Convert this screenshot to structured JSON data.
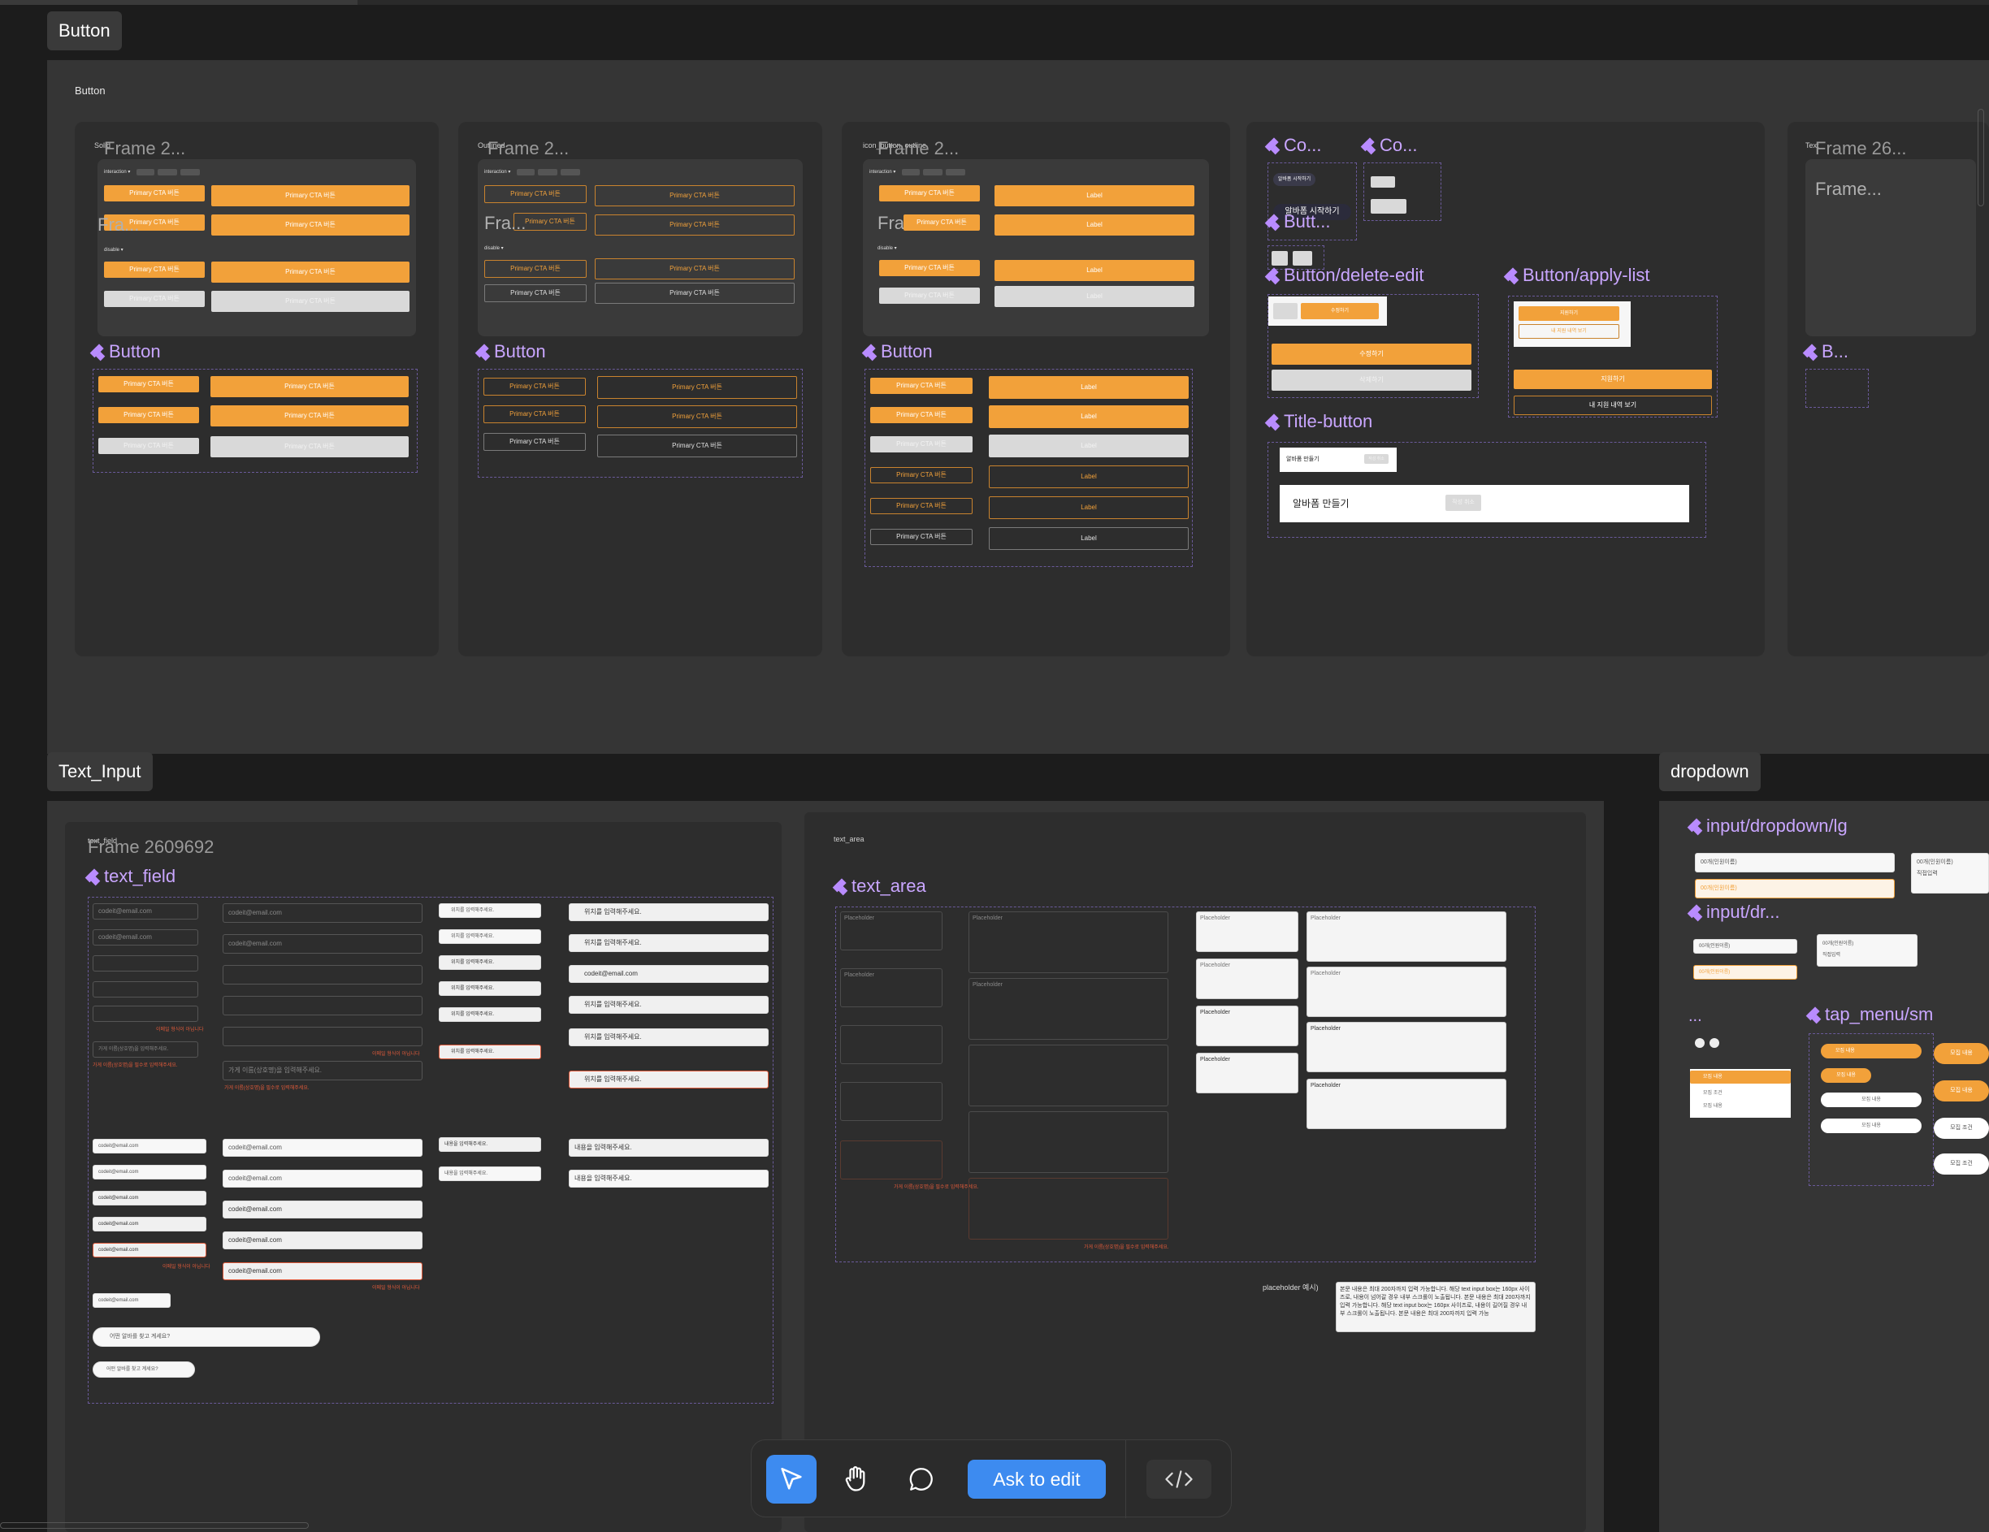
{
  "sections": {
    "button": {
      "tab": "Button",
      "panel_label": "Button",
      "cards": [
        {
          "frame_title": "Frame 2...",
          "small_label": "Solid",
          "sub_title": "Fra...",
          "component_title": "Button"
        },
        {
          "frame_title": "Frame 2...",
          "small_label": "Outlined",
          "sub_title": "Fra...",
          "component_title": "Button"
        },
        {
          "frame_title": "Frame 2...",
          "small_label": "icon_button_outline",
          "sub_title": "Fra...",
          "component_title": "Button"
        }
      ],
      "card4": {
        "co1": "Co...",
        "co2": "Co...",
        "butt": "Butt...",
        "delete_edit": "Button/delete-edit",
        "apply_list": "Button/apply-list",
        "title_button": "Title-button",
        "start_label_small": "알바폼 시작하기",
        "start_label": "알바폼 시작하기",
        "edit_label": "수정하기",
        "delete_label": "삭제하기",
        "apply_label": "지원하기",
        "list_label": "내 지원 내역 보기",
        "title_btn_small": "알바폼 만들기",
        "title_btn_large": "알바폼 만들기",
        "title_btn_action": "작성 취소"
      },
      "card5": {
        "frame_title": "Frame 26...",
        "sub_title": "Frame...",
        "component_title": "B...",
        "small_label": "Text"
      },
      "interaction_label": "interaction ▾",
      "disable_label": "disable ▾",
      "chips": [
        "default",
        "hovered",
        "focused"
      ],
      "primary_cta": "Primary CTA 버튼",
      "label_text": "Label"
    },
    "text_input": {
      "tab": "Text_Input",
      "frame1": {
        "frame_title": "Frame 2609692",
        "small_label": "text_field",
        "component_title": "text_field"
      },
      "frame2": {
        "small_label": "text_area",
        "component_title": "text_area"
      },
      "email": "codeit@email.com",
      "placeholder_input": "위치를 입력해주세요.",
      "placeholder_name": "이메일을 입력해주세요",
      "error_msg": "이메일 형식이 아닙니다",
      "name_placeholder": "가게 이름(상호명)을 입력해주세요.",
      "name_error": "가게 이름(상호명)을 필수로 입력해주세요.",
      "content_placeholder": "내용을 입력해주세요.",
      "search_placeholder": "어떤 알바를 찾고 계세요?",
      "ta_placeholder": "Placeholder",
      "ta_error": "가게 이름(상호명)을 필수로 입력해주세요.",
      "placeholder_example_label": "placeholder 예시)",
      "placeholder_example_text": "본문 내용은 최대 200자까지 입력 가능합니다. 해당 text input box는 160px 사이즈로, 내용이 넘어갈 경우 내부 스크롤이 노출됩니다. 본문 내용은 최대 200자까지 입력 가능합니다. 해당 text input box는 160px 사이즈로, 내용이 길어질 경우 내부 스크롤이 노출됩니다. 본문 내용은 최대 200자까지 입력 가능"
    },
    "dropdown": {
      "tab": "dropdown",
      "input_lg": "input/dropdown/lg",
      "input_dr": "input/dr...",
      "ellipsis": "...",
      "tap_menu": "tap_menu/sm",
      "option1": "00개(인원이름)",
      "option2": "00개(인원이름)",
      "direct": "직접입력",
      "menu_item": "모집 내용",
      "menu_item2": "모집 조건"
    }
  },
  "toolbar": {
    "ask_to_edit": "Ask to edit",
    "tools": [
      "cursor-icon",
      "hand-icon",
      "comment-icon",
      "code-icon"
    ],
    "accent": "#3d8bf0"
  },
  "colors": {
    "primary_orange": "#f2a13a",
    "component_purple": "#b98cff",
    "canvas": "#1c1c1c"
  }
}
